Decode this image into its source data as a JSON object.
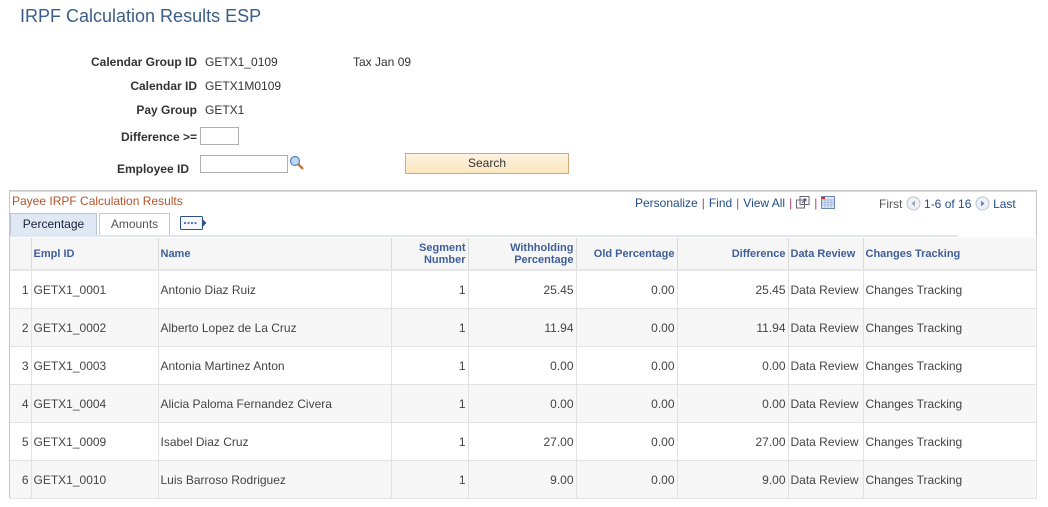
{
  "page": {
    "title": "IRPF Calculation Results ESP"
  },
  "form": {
    "calendar_group_id": {
      "label": "Calendar Group ID",
      "value": "GETX1_0109",
      "description": "Tax Jan 09"
    },
    "calendar_id": {
      "label": "Calendar ID",
      "value": "GETX1M0109"
    },
    "pay_group": {
      "label": "Pay Group",
      "value": "GETX1"
    },
    "difference": {
      "label": "Difference >=",
      "value": ""
    },
    "employee_id": {
      "label": "Employee ID",
      "value": ""
    },
    "search_button": "Search"
  },
  "grid": {
    "title": "Payee IRPF Calculation Results",
    "toolbar": {
      "personalize": "Personalize",
      "find": "Find",
      "view_all": "View All",
      "first": "First",
      "range": "1-6 of 16",
      "last": "Last"
    },
    "tabs": [
      {
        "label": "Percentage",
        "active": true
      },
      {
        "label": "Amounts",
        "active": false
      }
    ],
    "columns": [
      "",
      "Empl ID",
      "Name",
      "Segment Number",
      "Withholding Percentage",
      "Old Percentage",
      "Difference",
      "Data Review",
      "Changes Tracking"
    ],
    "rows": [
      {
        "n": "1",
        "empl_id": "GETX1_0001",
        "name": "Antonio Diaz Ruiz",
        "segment": "1",
        "withholding": "25.45",
        "old": "0.00",
        "difference": "25.45",
        "data_review": "Data Review",
        "changes_tracking": "Changes Tracking"
      },
      {
        "n": "2",
        "empl_id": "GETX1_0002",
        "name": "Alberto Lopez de La Cruz",
        "segment": "1",
        "withholding": "11.94",
        "old": "0.00",
        "difference": "11.94",
        "data_review": "Data Review",
        "changes_tracking": "Changes Tracking"
      },
      {
        "n": "3",
        "empl_id": "GETX1_0003",
        "name": "Antonia Martinez Anton",
        "segment": "1",
        "withholding": "0.00",
        "old": "0.00",
        "difference": "0.00",
        "data_review": "Data Review",
        "changes_tracking": "Changes Tracking"
      },
      {
        "n": "4",
        "empl_id": "GETX1_0004",
        "name": "Alicia Paloma Fernandez Civera",
        "segment": "1",
        "withholding": "0.00",
        "old": "0.00",
        "difference": "0.00",
        "data_review": "Data Review",
        "changes_tracking": "Changes Tracking"
      },
      {
        "n": "5",
        "empl_id": "GETX1_0009",
        "name": "Isabel Diaz Cruz",
        "segment": "1",
        "withholding": "27.00",
        "old": "0.00",
        "difference": "27.00",
        "data_review": "Data Review",
        "changes_tracking": "Changes Tracking"
      },
      {
        "n": "6",
        "empl_id": "GETX1_0010",
        "name": "Luis Barroso Rodriguez",
        "segment": "1",
        "withholding": "9.00",
        "old": "0.00",
        "difference": "9.00",
        "data_review": "Data Review",
        "changes_tracking": "Changes Tracking"
      }
    ]
  }
}
